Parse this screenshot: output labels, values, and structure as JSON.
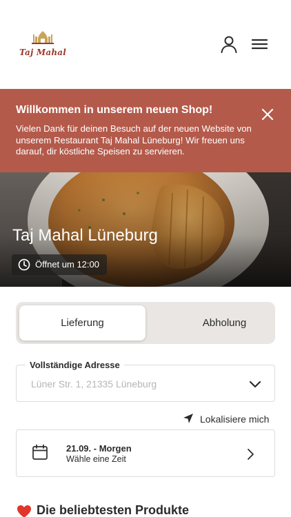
{
  "header": {
    "logo_text": "Taj Mahal",
    "icons": {
      "account": "user-icon",
      "menu": "hamburger-menu-icon",
      "logo": "taj-mahal-logo"
    }
  },
  "banner": {
    "title": "Willkommen in unserem neuen Shop!",
    "text": "Vielen Dank für deinen Besuch auf der neuen Website von unserem Restaurant Taj Mahal Lüneburg! Wir freuen uns darauf, dir köstliche Speisen zu servieren.",
    "background": "#b45a4b"
  },
  "hero": {
    "restaurant_name": "Taj Mahal Lüneburg",
    "opening_text": "Öffnet um 12:00"
  },
  "order_mode": {
    "options": [
      {
        "label": "Lieferung",
        "selected": true
      },
      {
        "label": "Abholung",
        "selected": false
      }
    ]
  },
  "address": {
    "label": "Vollständige Adresse",
    "placeholder": "Lüner Str. 1, 21335 Lüneburg",
    "value": ""
  },
  "locate": {
    "label": "Lokalisiere mich"
  },
  "time": {
    "date": "21.09. - Morgen",
    "subtitle": "Wähle eine Zeit"
  },
  "popular": {
    "title": "Die beliebtesten Produkte"
  }
}
